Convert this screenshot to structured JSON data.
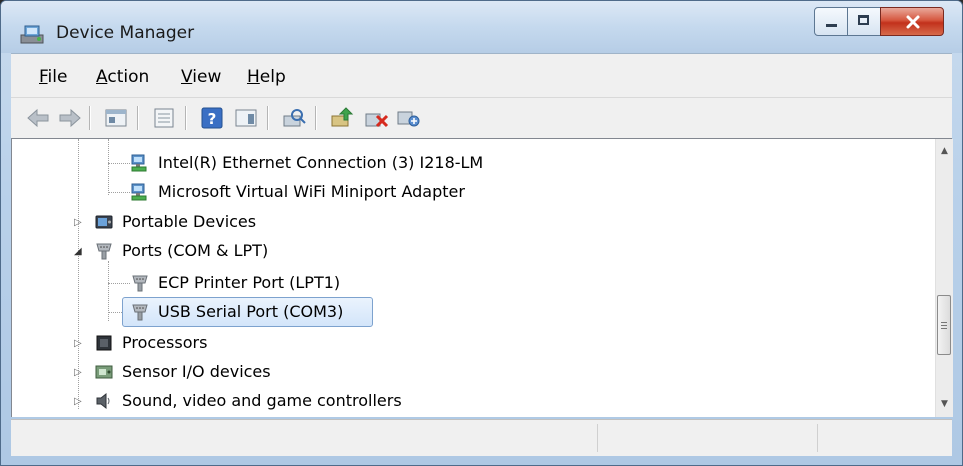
{
  "window": {
    "title": "Device Manager"
  },
  "menu": [
    {
      "label": "File",
      "underline": "F",
      "rest": "ile"
    },
    {
      "label": "Action",
      "underline": "A",
      "rest": "ction"
    },
    {
      "label": "View",
      "underline": "V",
      "rest": "iew"
    },
    {
      "label": "Help",
      "underline": "H",
      "rest": "elp"
    }
  ],
  "toolbar": {
    "buttons": [
      "back-icon",
      "forward-icon",
      "properties-icon",
      "show-hide-console-tree-icon",
      "help-icon",
      "action-pane-icon",
      "scan-hardware-icon",
      "update-driver-icon",
      "uninstall-icon",
      "disable-icon"
    ]
  },
  "tree": {
    "items": [
      {
        "label": "Intel(R) Ethernet Connection (3) I218-LM",
        "icon": "network-adapter-icon"
      },
      {
        "label": "Microsoft Virtual WiFi Miniport Adapter",
        "icon": "network-adapter-icon"
      },
      {
        "label": "Portable Devices",
        "icon": "portable-device-icon"
      },
      {
        "label": "Ports (COM & LPT)",
        "icon": "port-icon"
      },
      {
        "label": "ECP Printer Port (LPT1)",
        "icon": "port-icon"
      },
      {
        "label": "USB Serial Port (COM3)",
        "icon": "port-icon"
      },
      {
        "label": "Processors",
        "icon": "processor-icon"
      },
      {
        "label": "Sensor I/O devices",
        "icon": "sensor-icon"
      },
      {
        "label": "Sound, video and game controllers",
        "icon": "speaker-icon"
      }
    ]
  },
  "colors": {
    "selection": "#d3e5fa",
    "close_button": "#c2311c"
  }
}
